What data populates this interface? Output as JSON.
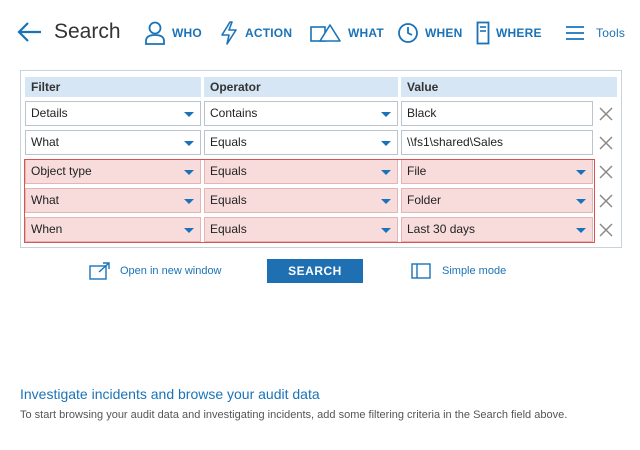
{
  "header": {
    "title": "Search",
    "nav": [
      {
        "label": "WHO",
        "icon": "user-icon"
      },
      {
        "label": "ACTION",
        "icon": "lightning-icon"
      },
      {
        "label": "WHAT",
        "icon": "shapes-icon"
      },
      {
        "label": "WHEN",
        "icon": "clock-icon"
      },
      {
        "label": "WHERE",
        "icon": "server-icon"
      },
      {
        "label": "Tools",
        "icon": "hamburger-icon"
      }
    ]
  },
  "table": {
    "headers": {
      "filter": "Filter",
      "operator": "Operator",
      "value": "Value"
    },
    "rows": [
      {
        "filter": "Details",
        "operator": "Contains",
        "value": "Black",
        "highlighted": false
      },
      {
        "filter": "What",
        "operator": "Equals",
        "value": "\\\\fs1\\shared\\Sales",
        "highlighted": false
      },
      {
        "filter": "Object type",
        "operator": "Equals",
        "value": "File",
        "highlighted": true
      },
      {
        "filter": "What",
        "operator": "Equals",
        "value": "Folder",
        "highlighted": true
      },
      {
        "filter": "When",
        "operator": "Equals",
        "value": "Last 30 days",
        "highlighted": true
      }
    ]
  },
  "actions": {
    "open_new_window": "Open in new window",
    "search": "SEARCH",
    "simple_mode": "Simple mode"
  },
  "info": {
    "title": "Investigate incidents and browse your audit data",
    "text": "To start browsing your audit data and investigating incidents, add some filtering criteria in the Search field above."
  },
  "colors": {
    "accent": "#1a73b8",
    "button": "#1f6fb3",
    "header_bg": "#d6e6f4",
    "highlight_bg": "#f8dcdc",
    "highlight_border": "#d9534f"
  }
}
